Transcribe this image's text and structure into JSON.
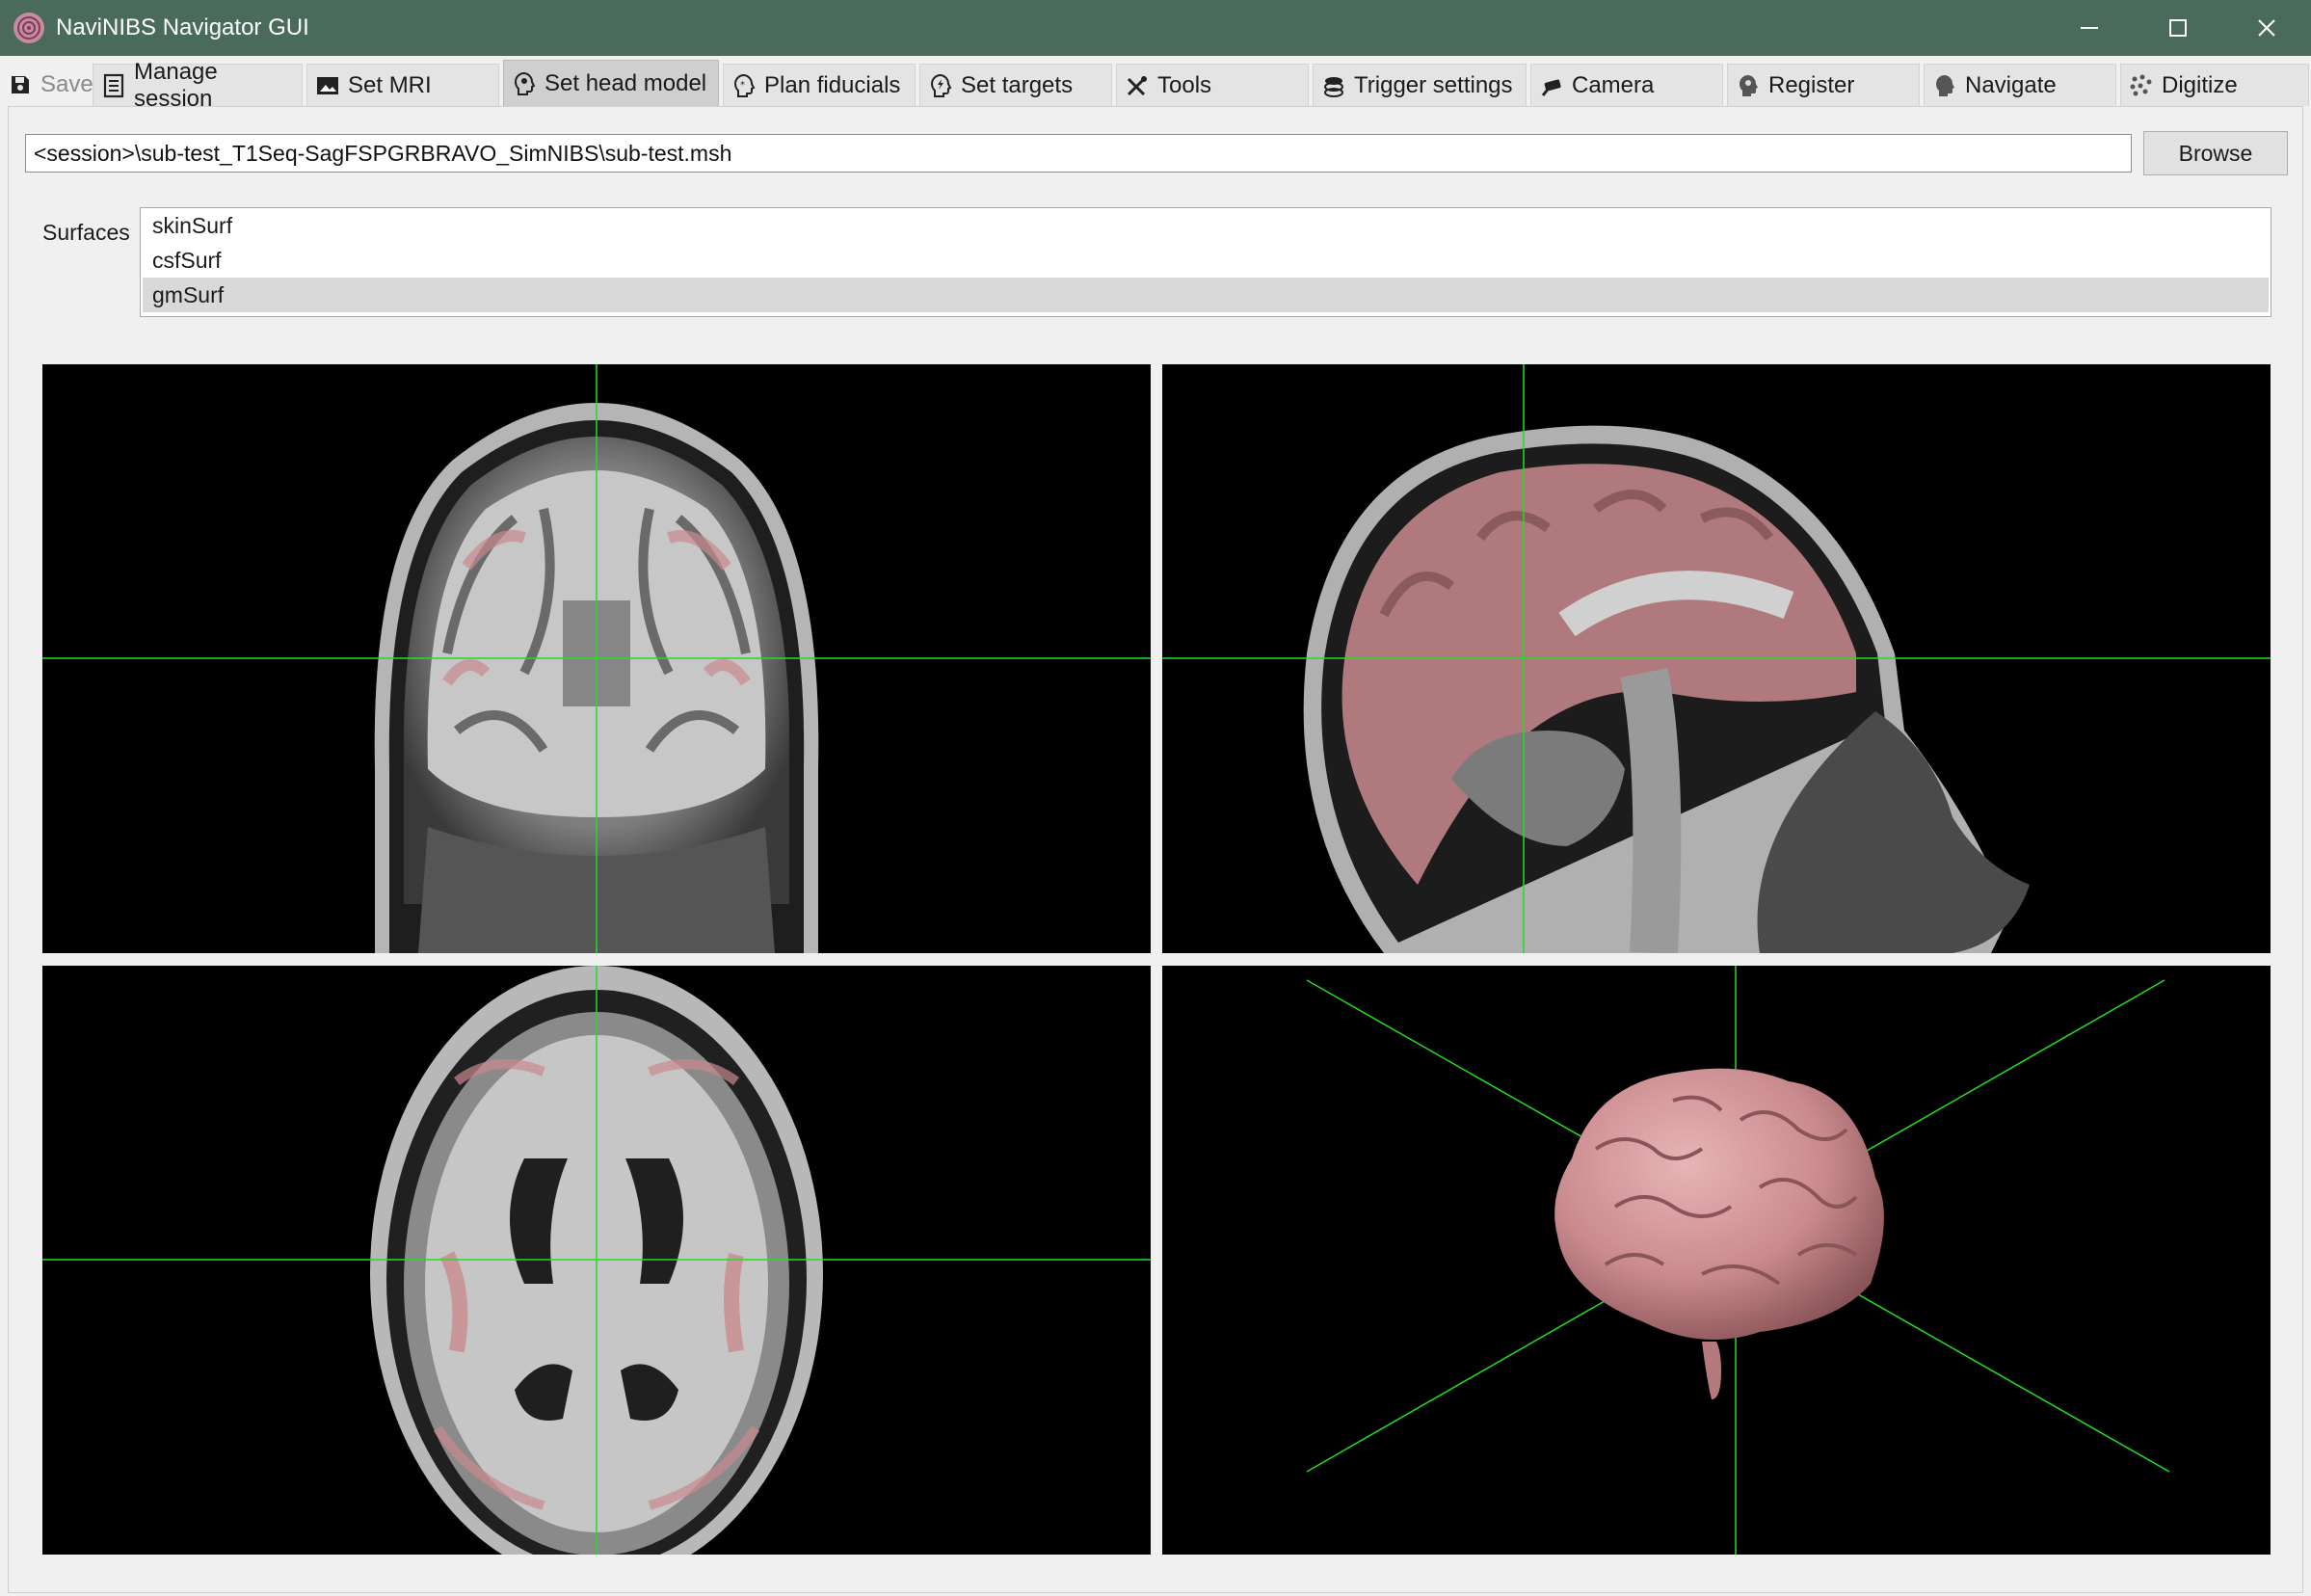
{
  "window": {
    "title": "NaviNIBS Navigator GUI",
    "accent_color": "#4a6b5b",
    "controls": [
      "minimize-icon",
      "maximize-icon",
      "close-icon"
    ]
  },
  "tabs": [
    {
      "label": "Save",
      "icon": "save-icon",
      "state": "disabled"
    },
    {
      "label": "Manage session",
      "icon": "document-icon"
    },
    {
      "label": "Set MRI",
      "icon": "image-icon"
    },
    {
      "label": "Set head model",
      "icon": "head-icon",
      "state": "active"
    },
    {
      "label": "Plan fiducials",
      "icon": "head-target-icon"
    },
    {
      "label": "Set targets",
      "icon": "head-bolt-icon"
    },
    {
      "label": "Tools",
      "icon": "tools-icon"
    },
    {
      "label": "Trigger settings",
      "icon": "trigger-icon"
    },
    {
      "label": "Camera",
      "icon": "camera-icon"
    },
    {
      "label": "Register",
      "icon": "register-icon"
    },
    {
      "label": "Navigate",
      "icon": "navigate-icon"
    },
    {
      "label": "Digitize",
      "icon": "digitize-icon"
    }
  ],
  "head_model": {
    "path": "<session>\\sub-test_T1Seq-SagFSPGRBRAVO_SimNIBS\\sub-test.msh",
    "browse_label": "Browse",
    "surfaces_label": "Surfaces",
    "surfaces": [
      "skinSurf",
      "csfSurf",
      "gmSurf"
    ],
    "selected_surface": "gmSurf"
  },
  "views": {
    "slices": [
      "coronal",
      "sagittal",
      "axial"
    ],
    "render_3d": "gmSurf",
    "crosshair_color": "#22dd22",
    "overlay_color": "#c98a8e"
  }
}
